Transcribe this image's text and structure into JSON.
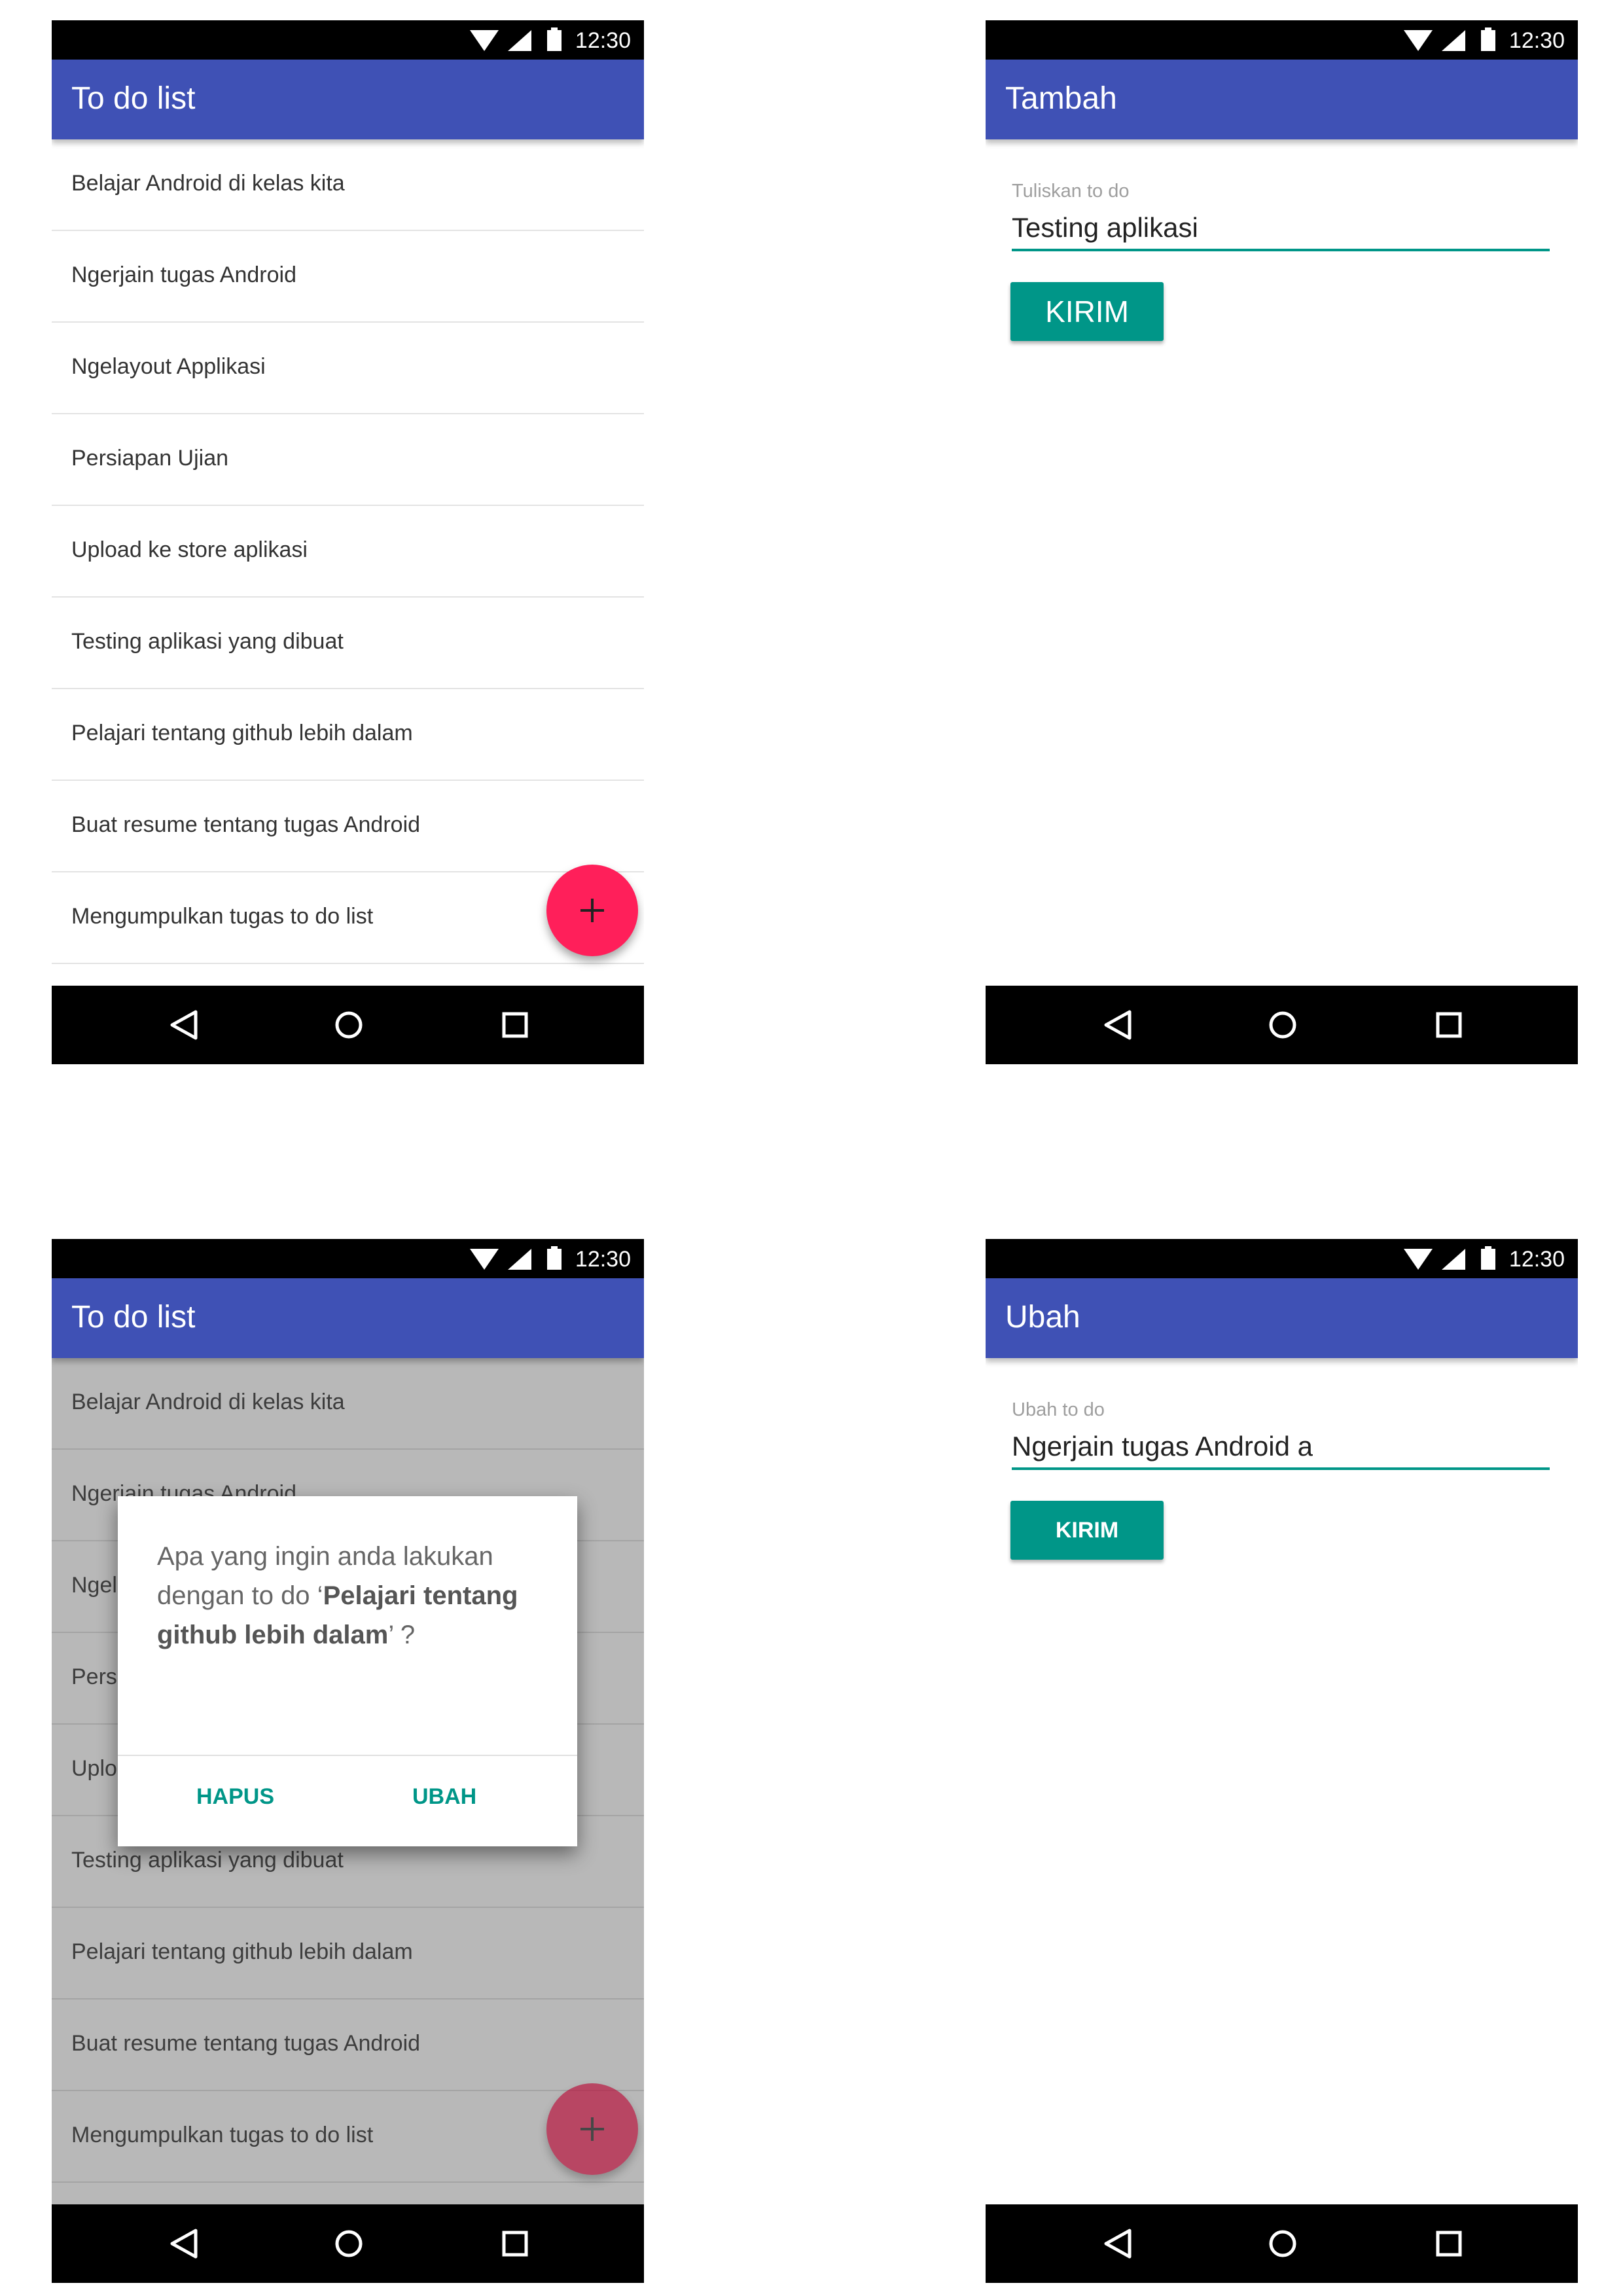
{
  "status_bar": {
    "time": "12:30"
  },
  "screen_list": {
    "title": "To do list",
    "items": [
      "Belajar Android di kelas kita",
      "Ngerjain tugas Android",
      "Ngelayout Applikasi",
      "Persiapan Ujian",
      "Upload ke store aplikasi",
      "Testing aplikasi yang dibuat",
      "Pelajari tentang github lebih dalam",
      "Buat resume tentang tugas Android",
      "Mengumpulkan tugas to do list"
    ],
    "fab_label": "+"
  },
  "screen_add": {
    "title": "Tambah",
    "field_label": "Tuliskan to do",
    "field_value": "Testing aplikasi",
    "button_label": "KIRIM"
  },
  "screen_dialog": {
    "title": "To do list",
    "dialog": {
      "message_prefix": "Apa yang ingin anda lakukan dengan to do ‘",
      "message_item": "Pelajari tentang github lebih dalam",
      "message_suffix": "’ ?",
      "delete_label": "HAPUS",
      "edit_label": "UBAH"
    }
  },
  "screen_edit": {
    "title": "Ubah",
    "field_label": "Ubah to do",
    "field_value": "Ngerjain tugas Android a",
    "button_label": "KIRIM"
  },
  "colors": {
    "app_bar": "#3f51b5",
    "accent": "#009688",
    "fab": "#ff1f5a",
    "system_bar": "#000000"
  }
}
